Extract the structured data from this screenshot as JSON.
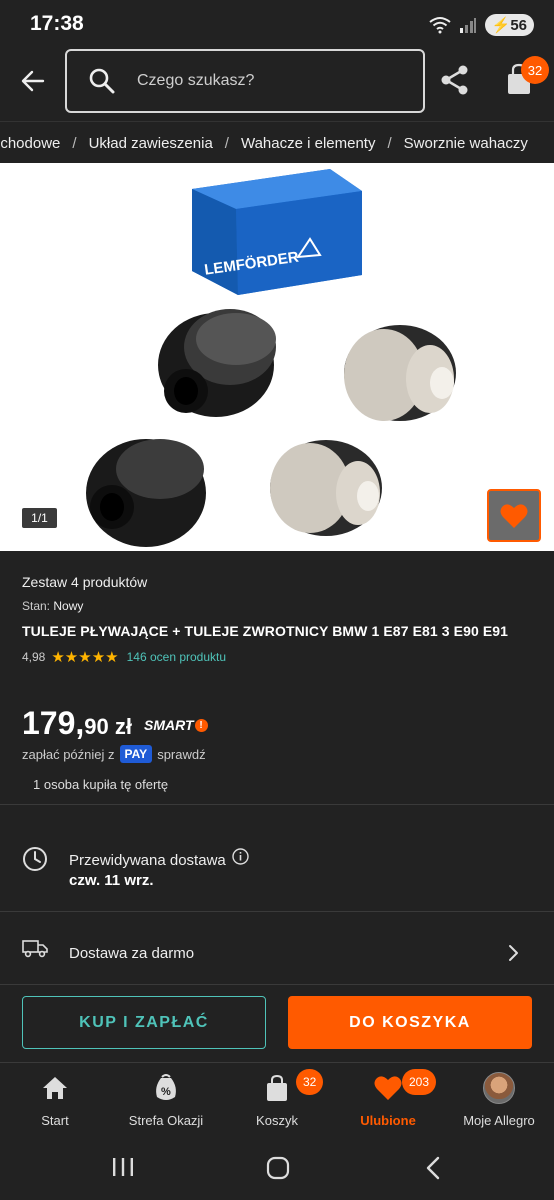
{
  "status_bar": {
    "time": "17:38",
    "battery": "56"
  },
  "search": {
    "placeholder": "Czego szukasz?"
  },
  "header": {
    "cart_count": "32"
  },
  "breadcrumb": [
    "ochodowe",
    "Układ zawieszenia",
    "Wahacze i elementy",
    "Sworznie wahaczy"
  ],
  "gallery": {
    "counter": "1/1",
    "box_brand": "LEMFÖRDER"
  },
  "product": {
    "set_label": "Zestaw 4 produktów",
    "condition_label": "Stan:",
    "condition_value": "Nowy",
    "title": "TULEJE PŁYWAJĄCE + TULEJE ZWROTNICY BMW 1 E87 E81 3 E90 E91",
    "rating": "4,98",
    "stars": "★★★★★",
    "reviews": "146 ocen produktu"
  },
  "price": {
    "whole": "179,",
    "fraction": "90 zł",
    "smart": "SMART",
    "pay_prefix": "zapłać później z",
    "pay_badge": "PAY",
    "pay_suffix": "sprawdź",
    "buyers": "1 osoba kupiła tę ofertę"
  },
  "delivery": {
    "label": "Przewidywana dostawa",
    "date": "czw. 11 wrz.",
    "free": "Dostawa za darmo"
  },
  "actions": {
    "buy": "KUP I ZAPŁAĆ",
    "cart": "DO KOSZYKA"
  },
  "bottom_nav": {
    "items": [
      {
        "label": "Start"
      },
      {
        "label": "Strefa Okazji"
      },
      {
        "label": "Koszyk",
        "badge": "32"
      },
      {
        "label": "Ulubione",
        "badge": "203"
      },
      {
        "label": "Moje Allegro"
      }
    ]
  },
  "colors": {
    "accent": "#ff5a00",
    "teal": "#4fc3b9",
    "background": "#222222",
    "star": "#ffb400",
    "pay": "#1f5bd6"
  }
}
